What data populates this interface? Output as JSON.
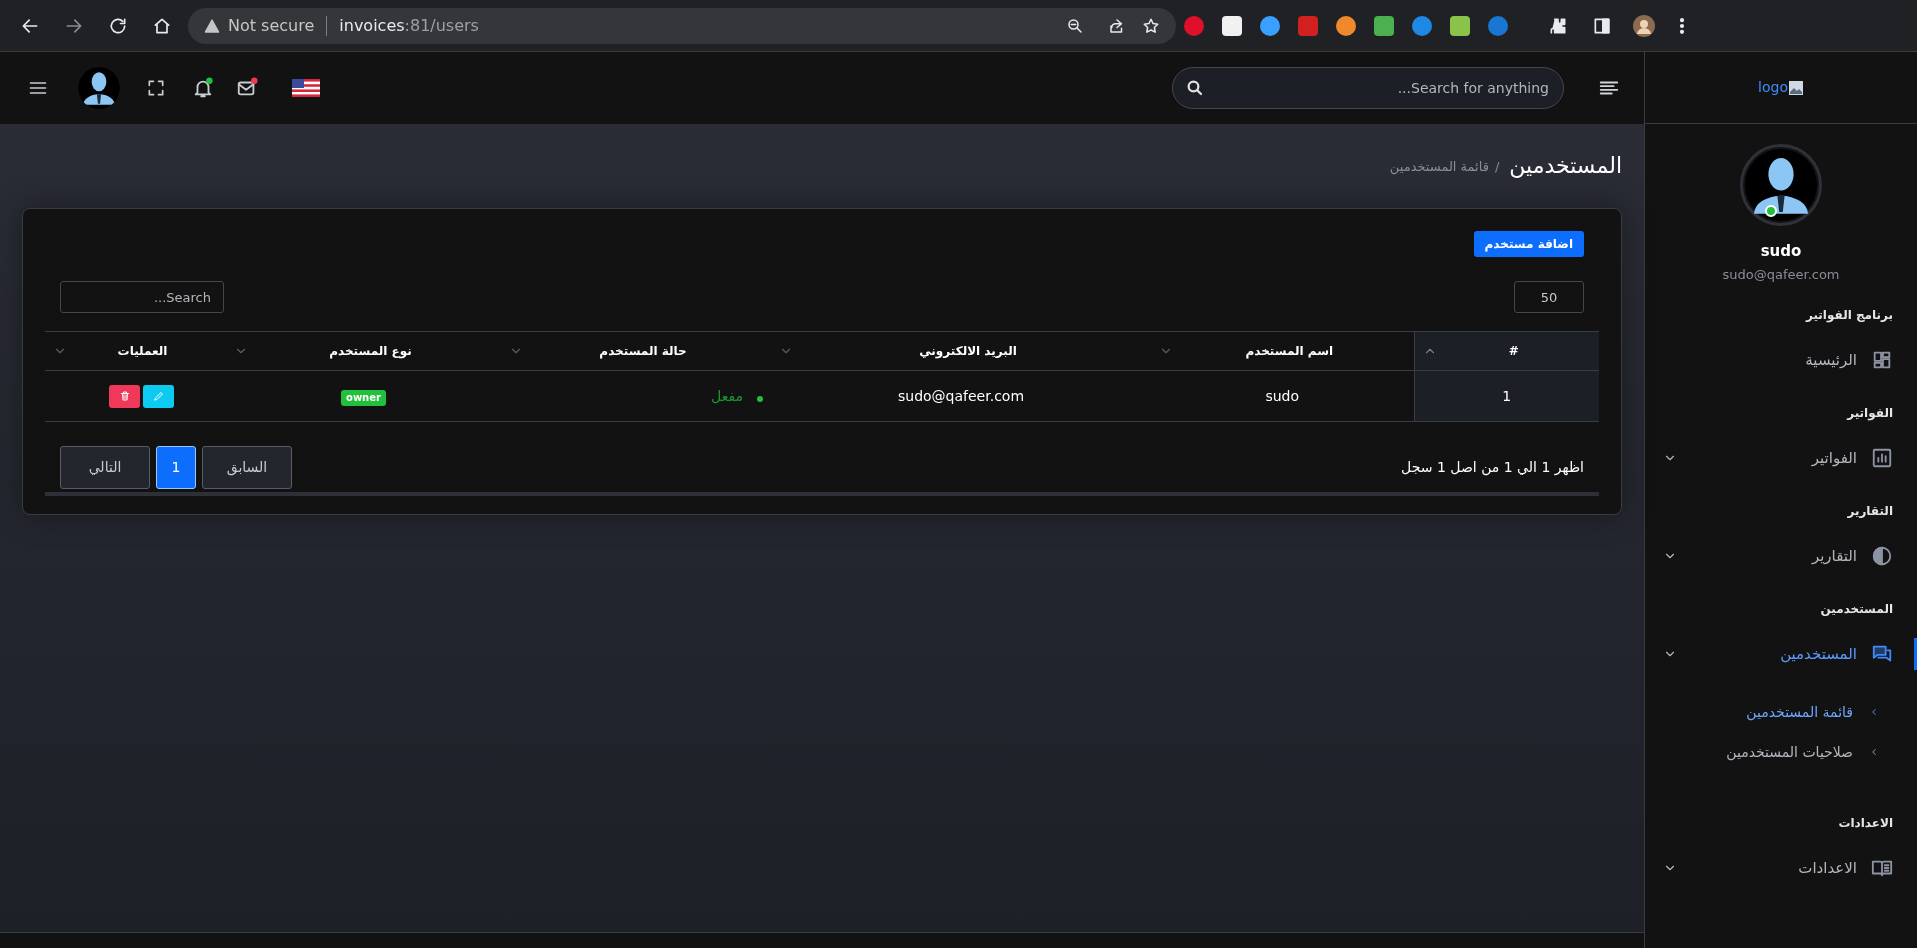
{
  "browser": {
    "security": "Not secure",
    "url_host": "invoices",
    "url_rest": ":81/users"
  },
  "topbar": {
    "search_placeholder": "Search for anything...",
    "bell_dot": true,
    "mail_dot": true
  },
  "sidebar": {
    "logo": "logo",
    "user": {
      "name": "sudo",
      "email": "sudo@qafeer.com",
      "online": true
    },
    "sections": [
      {
        "title": "برنامج الفواتير",
        "items": [
          {
            "label": "الرئيسية",
            "kind": "grid",
            "expandable": false,
            "active": false
          }
        ]
      },
      {
        "title": "الفواتير",
        "items": [
          {
            "label": "الفواتير",
            "kind": "chart",
            "expandable": true,
            "active": false
          }
        ]
      },
      {
        "title": "التقارير",
        "items": [
          {
            "label": "التقارير",
            "kind": "pie",
            "expandable": true,
            "active": false
          }
        ]
      },
      {
        "title": "المستخدمين",
        "items": [
          {
            "label": "المستخدمين",
            "kind": "chat",
            "expandable": true,
            "active": true,
            "children": [
              {
                "label": "قائمة المستخدمين",
                "active": true
              },
              {
                "label": "صلاحيات المستخدمين",
                "active": false
              }
            ]
          }
        ]
      },
      {
        "title": "الاعدادات",
        "items": [
          {
            "label": "الاعدادات",
            "kind": "book",
            "expandable": true,
            "active": false
          }
        ]
      }
    ]
  },
  "page": {
    "title": "المستخدمين",
    "separator": "/",
    "breadcrumb": "قائمة المستخدمين"
  },
  "card": {
    "add_button": "اضافة مستخدم",
    "page_size": "50",
    "search_placeholder": "Search...",
    "table": {
      "columns": [
        {
          "label": "#",
          "sorted": true
        },
        {
          "label": "اسم المستخدم",
          "sorted": false
        },
        {
          "label": "البريد الالكتروني",
          "sorted": false
        },
        {
          "label": "حالة المستخدم",
          "sorted": false
        },
        {
          "label": "نوع المستخدم",
          "sorted": false
        },
        {
          "label": "العمليات",
          "sorted": false
        }
      ],
      "rows": [
        {
          "number": "1",
          "name": "sudo",
          "email": "sudo@qafeer.com",
          "status": {
            "label": "مفعل",
            "active": true
          },
          "type": "owner"
        }
      ]
    },
    "info": "اظهر 1 الي 1 من اصل 1 سجل",
    "pagination": [
      {
        "label": "السابق",
        "selected": false
      },
      {
        "label": "1",
        "selected": true
      },
      {
        "label": "التالي",
        "selected": false
      }
    ]
  }
}
